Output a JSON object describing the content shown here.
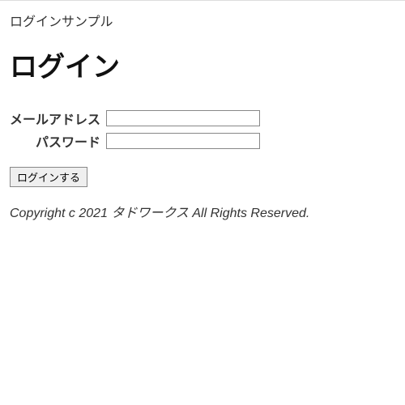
{
  "breadcrumb": "ログインサンプル",
  "page_title": "ログイン",
  "form": {
    "email_label": "メールアドレス",
    "email_value": "",
    "password_label": "パスワード",
    "password_value": "",
    "submit_label": "ログインする"
  },
  "copyright": "Copyright c 2021 タドワークス All Rights Reserved."
}
